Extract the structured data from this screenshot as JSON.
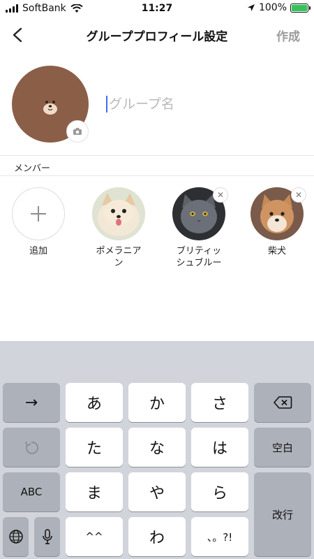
{
  "status_bar": {
    "carrier": "SoftBank",
    "time": "11:27",
    "battery": "100%"
  },
  "nav": {
    "title": "グループプロフィール設定",
    "create_label": "作成"
  },
  "group": {
    "name_placeholder": "グループ名",
    "name_value": ""
  },
  "members_label": "メンバー",
  "add_label": "追加",
  "members": [
    {
      "name": "ポメラニアン",
      "removable": false
    },
    {
      "name": "ブリティッシュブルー",
      "removable": true
    },
    {
      "name": "柴犬",
      "removable": true
    }
  ],
  "keyboard": {
    "row1": [
      "→",
      "あ",
      "か",
      "さ"
    ],
    "row2": [
      "た",
      "な",
      "は",
      "空白"
    ],
    "row3": [
      "ABC",
      "ま",
      "や",
      "ら"
    ],
    "row4": [
      "^^",
      "わ",
      "、。?!"
    ],
    "return_label": "改行"
  },
  "colors": {
    "accent": "#3b6ef0",
    "battery": "#32c45b",
    "avatar_brown": "#8b5e48"
  }
}
